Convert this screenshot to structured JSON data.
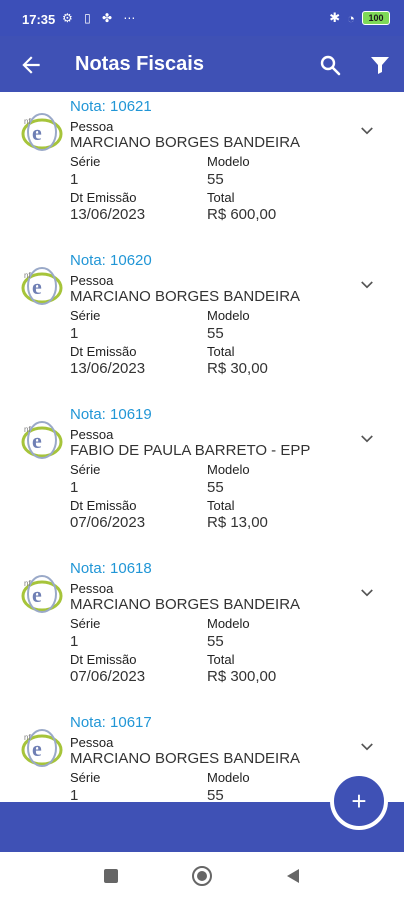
{
  "status": {
    "time": "17:35",
    "battery": "100"
  },
  "header": {
    "title": "Notas Fiscais"
  },
  "notes": [
    {
      "nota": "Nota: 10621",
      "pessoa_label": "Pessoa",
      "pessoa": "MARCIANO BORGES BANDEIRA",
      "serie_label": "Série",
      "serie": "1",
      "modelo_label": "Modelo",
      "modelo": "55",
      "dt_label": "Dt Emissão",
      "dt": "13/06/2023",
      "total_label": "Total",
      "total": "R$ 600,00"
    },
    {
      "nota": "Nota: 10620",
      "pessoa_label": "Pessoa",
      "pessoa": "MARCIANO BORGES BANDEIRA",
      "serie_label": "Série",
      "serie": "1",
      "modelo_label": "Modelo",
      "modelo": "55",
      "dt_label": "Dt Emissão",
      "dt": "13/06/2023",
      "total_label": "Total",
      "total": "R$ 30,00"
    },
    {
      "nota": "Nota: 10619",
      "pessoa_label": "Pessoa",
      "pessoa": "FABIO DE PAULA BARRETO - EPP",
      "serie_label": "Série",
      "serie": "1",
      "modelo_label": "Modelo",
      "modelo": "55",
      "dt_label": "Dt Emissão",
      "dt": "07/06/2023",
      "total_label": "Total",
      "total": "R$ 13,00"
    },
    {
      "nota": "Nota: 10618",
      "pessoa_label": "Pessoa",
      "pessoa": "MARCIANO BORGES BANDEIRA",
      "serie_label": "Série",
      "serie": "1",
      "modelo_label": "Modelo",
      "modelo": "55",
      "dt_label": "Dt Emissão",
      "dt": "07/06/2023",
      "total_label": "Total",
      "total": "R$ 300,00"
    },
    {
      "nota": "Nota: 10617",
      "pessoa_label": "Pessoa",
      "pessoa": "MARCIANO BORGES BANDEIRA",
      "serie_label": "Série",
      "serie": "1",
      "modelo_label": "Modelo",
      "modelo": "55",
      "dt_label": "",
      "dt": "",
      "total_label": "",
      "total": ""
    }
  ],
  "fab": {
    "label": "+"
  },
  "colors": {
    "primary": "#3f51b5",
    "link": "#2196d6"
  }
}
